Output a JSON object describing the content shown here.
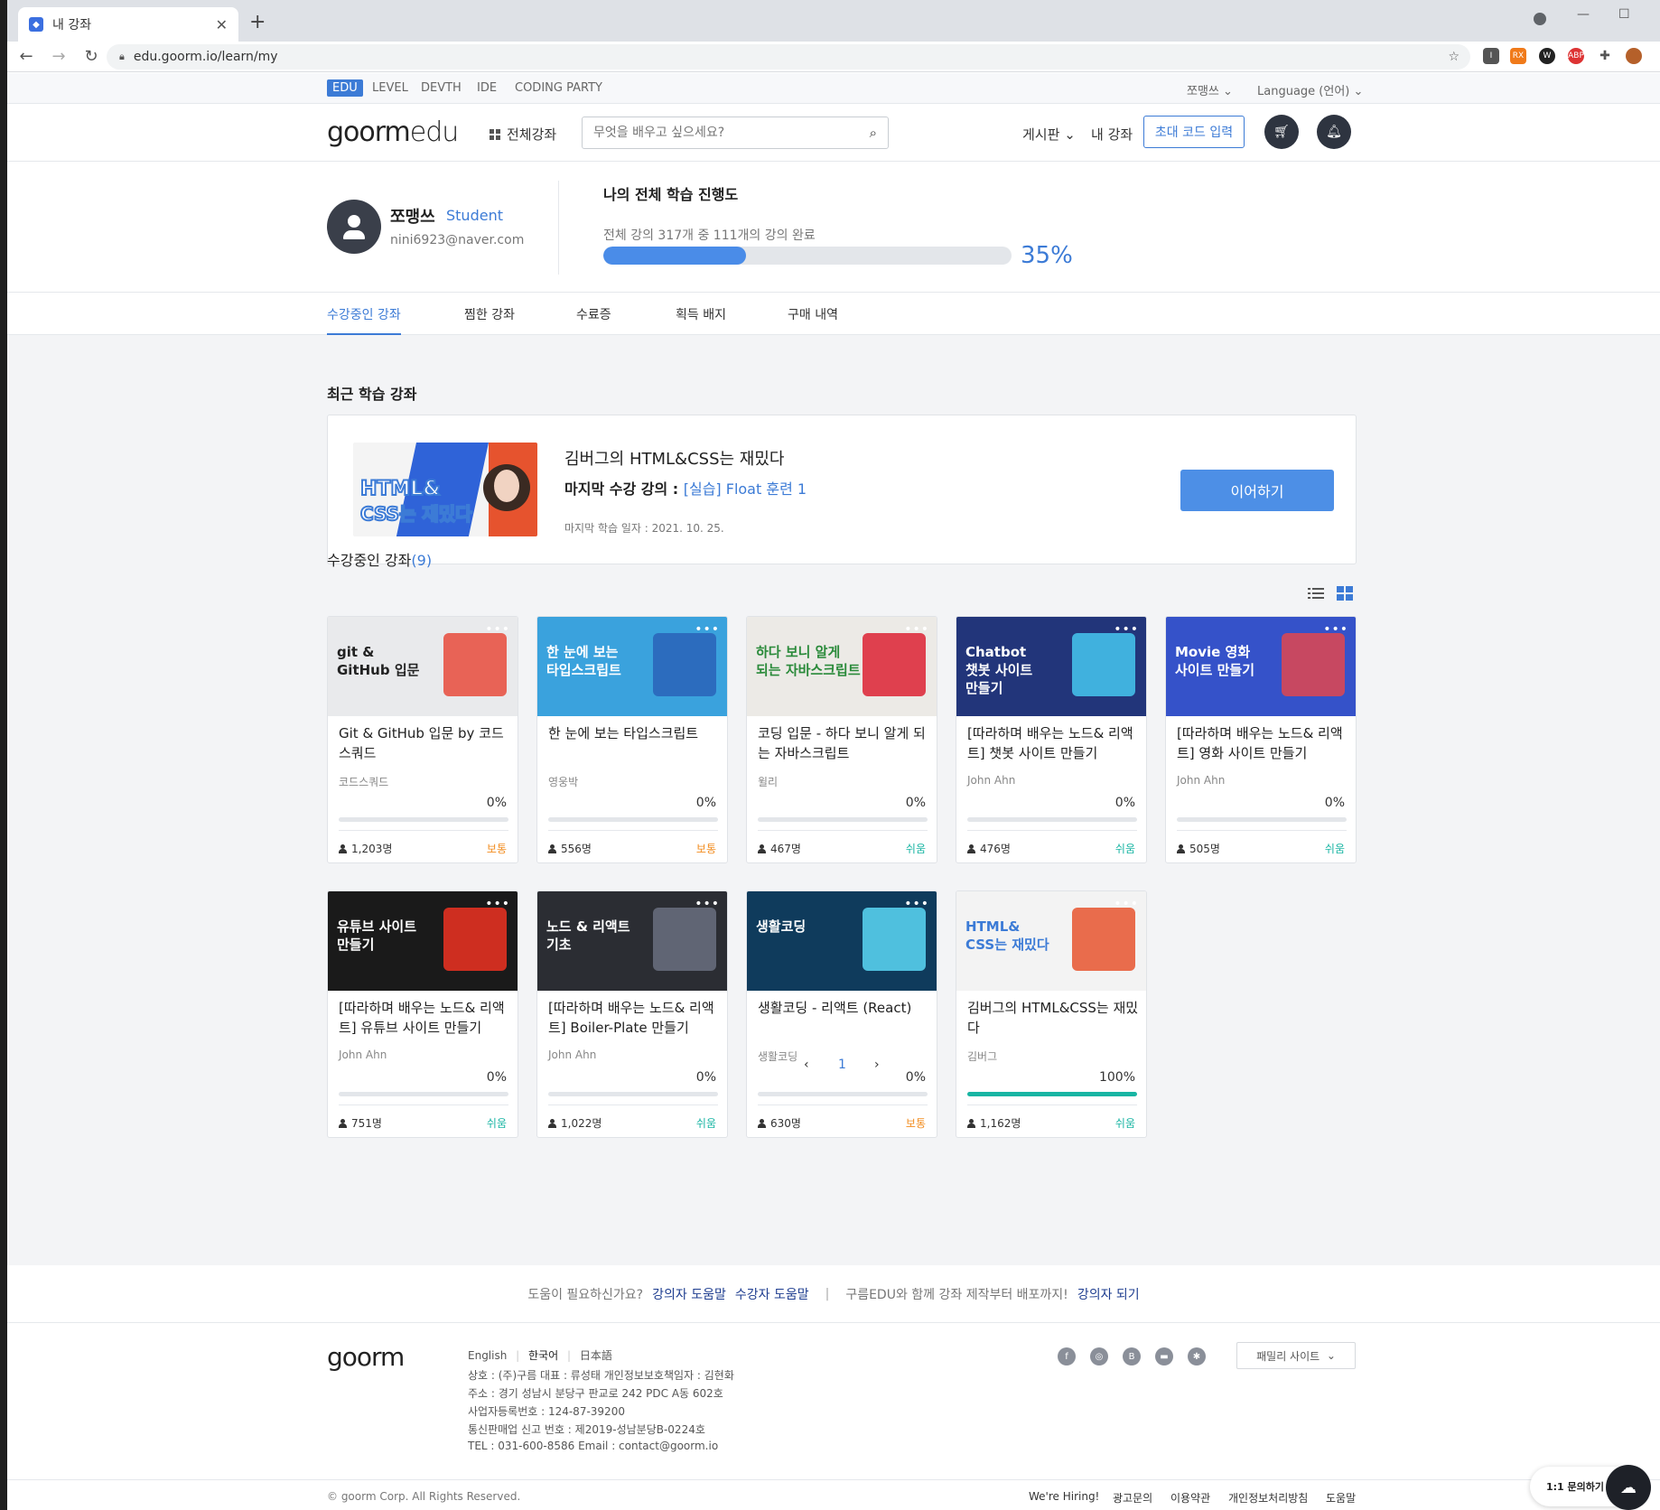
{
  "browser": {
    "tab_title": "내 강좌",
    "url": "edu.goorm.io/learn/my"
  },
  "services": [
    "EDU",
    "LEVEL",
    "DEVTH",
    "IDE",
    "CODING PARTY"
  ],
  "top_user": "쪼맹쓰",
  "language": "Language (언어)",
  "logo": {
    "goorm": "goorm",
    "edu": "edu"
  },
  "nav": {
    "all_courses": "전체강좌",
    "search_placeholder": "무엇을 배우고 싶으세요?",
    "board": "게시판",
    "my_courses": "내 강좌",
    "invite": "초대 코드 입력"
  },
  "profile": {
    "name": "쪼맹쓰",
    "role": "Student",
    "email": "nini6923@naver.com",
    "progress_title": "나의 전체 학습 진행도",
    "progress_text": "전체 강의 317개 중 111개의 강의 완료",
    "progress_percent": "35%",
    "progress_value": 0.35
  },
  "tabs": [
    "수강중인 강좌",
    "찜한 강좌",
    "수료증",
    "획득 배지",
    "구매 내역"
  ],
  "recent": {
    "section_title": "최근 학습 강좌",
    "course_title": "김버그의 HTML&CSS는 재밌다",
    "last_label": "마지막 수강 강의 :",
    "last_lecture": "[실습] Float 훈련 1",
    "last_date": "마지막 학습 일자 : 2021. 10. 25.",
    "continue": "이어하기"
  },
  "enrolled": {
    "title": "수강중인 강좌",
    "count": "(9)",
    "courses": [
      {
        "title": "Git & GitHub 입문 by 코드스쿼드",
        "author": "코드스쿼드",
        "percent": "0%",
        "progress": 0,
        "users": "1,203명",
        "level": "보통",
        "level_kind": "mid",
        "thumb": {
          "bg": "#e9eaec",
          "text": "git & GitHub 입문",
          "fg": "#222",
          "accent": "#e84b3c"
        }
      },
      {
        "title": "한 눈에 보는 타입스크립트",
        "author": "영웅박",
        "percent": "0%",
        "progress": 0,
        "users": "556명",
        "level": "보통",
        "level_kind": "mid",
        "thumb": {
          "bg": "#3aa2dd",
          "text": "한 눈에 보는 타입스크립트",
          "fg": "#fff",
          "accent": "#2a63b8"
        }
      },
      {
        "title": "코딩 입문 - 하다 보니 알게 되는 자바스크립트",
        "author": "윌리",
        "percent": "0%",
        "progress": 0,
        "users": "467명",
        "level": "쉬움",
        "level_kind": "easy",
        "thumb": {
          "bg": "#eceae6",
          "text": "하다 보니 알게 되는 자바스크립트",
          "fg": "#2a8a3a",
          "accent": "#d23"
        }
      },
      {
        "title": "[따라하며 배우는 노드& 리액트] 챗봇 사이트 만들기",
        "author": "John Ahn",
        "percent": "0%",
        "progress": 0,
        "users": "476명",
        "level": "쉬움",
        "level_kind": "easy",
        "thumb": {
          "bg": "#22357a",
          "text": "Chatbot 챗봇 사이트 만들기",
          "fg": "#fff",
          "accent": "#45c7f0"
        }
      },
      {
        "title": "[따라하며 배우는 노드& 리액트] 영화 사이트 만들기",
        "author": "John Ahn",
        "percent": "0%",
        "progress": 0,
        "users": "505명",
        "level": "쉬움",
        "level_kind": "easy",
        "thumb": {
          "bg": "#3552c9",
          "text": "Movie 영화 사이트 만들기",
          "fg": "#fff",
          "accent": "#e0464f"
        }
      },
      {
        "title": "[따라하며 배우는 노드& 리액트] 유튜브 사이트 만들기",
        "author": "John Ahn",
        "percent": "0%",
        "progress": 0,
        "users": "751명",
        "level": "쉬움",
        "level_kind": "easy",
        "thumb": {
          "bg": "#1a1a1a",
          "text": "유튜브 사이트 만들기",
          "fg": "#fff",
          "accent": "#e32"
        }
      },
      {
        "title": "[따라하며 배우는 노드& 리액트] Boiler-Plate 만들기",
        "author": "John Ahn",
        "percent": "0%",
        "progress": 0,
        "users": "1,022명",
        "level": "쉬움",
        "level_kind": "easy",
        "thumb": {
          "bg": "#2b2d33",
          "text": "노드 & 리액트 기초",
          "fg": "#fff",
          "accent": "#6a7080"
        }
      },
      {
        "title": "생활코딩 - 리액트 (React)",
        "author": "생활코딩",
        "percent": "0%",
        "progress": 0,
        "users": "630명",
        "level": "보통",
        "level_kind": "mid",
        "thumb": {
          "bg": "#0f3b5c",
          "text": "생활코딩",
          "fg": "#fff",
          "accent": "#5ad8f5"
        }
      },
      {
        "title": "김버그의 HTML&CSS는 재밌다",
        "author": "김버그",
        "percent": "100%",
        "progress": 1,
        "users": "1,162명",
        "level": "쉬움",
        "level_kind": "easy",
        "thumb": {
          "bg": "#f3f3f3",
          "text": "HTML& CSS는 재밌다",
          "fg": "#3c7bd6",
          "accent": "#e6532e"
        }
      }
    ]
  },
  "pagination": {
    "prev": "‹",
    "current": "1",
    "next": "›"
  },
  "help": {
    "question": "도움이 필요하신가요?",
    "instructor_help": "강의자 도움말",
    "student_help": "수강자 도움말",
    "promo": "구름EDU와 함께 강좌 제작부터 배포까지!",
    "become": "강의자 되기"
  },
  "footer": {
    "logo": "goorm",
    "languages": [
      "English",
      "한국어",
      "日本語"
    ],
    "info": [
      "상호 : (주)구름    대표 : 류성태    개인정보보호책임자 : 김현화",
      "주소 : 경기 성남시 분당구 판교로 242 PDC A동 602호",
      "사업자등록번호 : 124-87-39200",
      "통신판매업 신고 번호 : 제2019-성남분당B-0224호",
      "TEL : 031-600-8586    Email : contact@goorm.io"
    ],
    "family": "패밀리 사이트",
    "copyright": "© goorm Corp. All Rights Reserved.",
    "links": [
      "We're Hiring!",
      "광고문의",
      "이용약관",
      "개인정보처리방침",
      "도움말"
    ]
  },
  "chat": "1:1 문의하기"
}
